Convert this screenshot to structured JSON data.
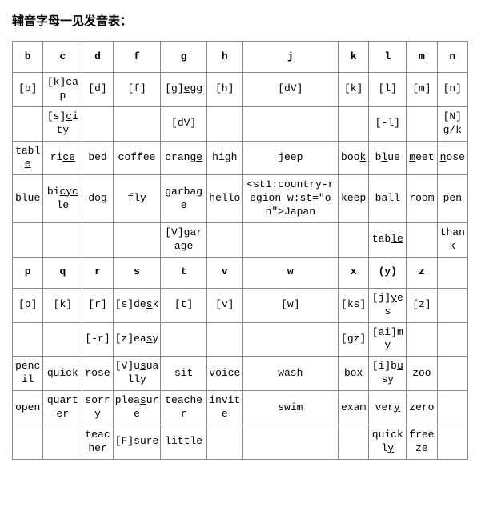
{
  "title": "辅音字母一见发音表：",
  "headers1": [
    "b",
    "c",
    "d",
    "f",
    "g",
    "h",
    "j",
    "k",
    "l",
    "m",
    "n"
  ],
  "headers2": [
    "p",
    "q",
    "r",
    "s",
    "t",
    "v",
    "w",
    "x",
    "(y)",
    "z",
    ""
  ],
  "r1": {
    "b": "[b]",
    "c_pre": "[k]",
    "c_ul": "c",
    "c_post": "ap",
    "d": "[d]",
    "f": "[f]",
    "g_pre": "[g]",
    "g_ul": "e",
    "g_post": "gg",
    "h": "[h]",
    "j": "[dV]",
    "k": "[k]",
    "l": "[l]",
    "m": "[m]",
    "n": "[n]"
  },
  "r2": {
    "c_pre": "[s]",
    "c_ul": "c",
    "c_post": "ity",
    "g": "[dV]",
    "l": "[-l]",
    "n_pre": "[N]",
    "n_ul": "g",
    "n_post": "/k"
  },
  "r3": {
    "b_pre": "tabl",
    "b_ul": "e",
    "c_pre": "ri",
    "c_ul": "ce",
    "d": "bed",
    "f": "coffee",
    "g_pre": "oran",
    "g_ul": "ge",
    "h": "high",
    "j": "jeep",
    "k_pre": "boo",
    "k_ul": "k",
    "l_pre": "b",
    "l_ul": "l",
    "l_post": "ue",
    "m_pre": "",
    "m_ul": "m",
    "m_post": "eet",
    "n_pre": "",
    "n_ul": "n",
    "n_post": "ose"
  },
  "r4": {
    "b": "blue",
    "c_pre": "bi",
    "c_ul": "cyc",
    "c_post": "le",
    "d": "dog",
    "f": "fly",
    "g_pre": "garba",
    "g_ul": "g",
    "g_post": "e",
    "h": "hello",
    "j": "<st1:country-region w:st=\"on\">Japan",
    "k_pre": "kee",
    "k_ul": "p",
    "l_pre": "ba",
    "l_ul": "ll",
    "m_pre": "roo",
    "m_ul": "m",
    "n_pre": "pe",
    "n_ul": "n"
  },
  "r5": {
    "g_pre": "[V]gar",
    "g_ul": "a",
    "g_post": "ge",
    "l_pre": "tab",
    "l_ul": "le",
    "n": "thank"
  },
  "r6": {
    "p": "[p]",
    "q": "[k]",
    "r": "[r]",
    "s_pre": "[s]de",
    "s_ul": "s",
    "s_post": "k",
    "t": "[t]",
    "v": "[v]",
    "w": "[w]",
    "x": "[ks]",
    "y_pre": "[j]",
    "y_ul": "y",
    "y_post": "es",
    "z": "[z]"
  },
  "r7": {
    "r": "[-r]",
    "s_pre": "[z]ea",
    "s_ul": "s",
    "s_post": "y",
    "x": "[gz]",
    "y_pre": "[ai]m",
    "y_ul": "y"
  },
  "r8": {
    "p": "pencil",
    "q": "quick",
    "r": "rose",
    "s_pre": "[V]u",
    "s_ul": "s",
    "s_post": "ually",
    "t": "sit",
    "v": "voice",
    "w": "wash",
    "x": "box",
    "y_pre": "[i]b",
    "y_ul": "u",
    "y_post": "sy",
    "z": "zoo"
  },
  "r9": {
    "p": "open",
    "q": "quarter",
    "r": "sorry",
    "s_pre": "plea",
    "s_ul": "s",
    "s_post": "ure",
    "t": "teacher",
    "v": "invite",
    "w": "swim",
    "x": "exam",
    "y_pre": "ver",
    "y_ul": "y",
    "z": "zero"
  },
  "r10": {
    "r": "teacher",
    "s_pre": "[F]",
    "s_ul": "s",
    "s_post": "ure",
    "t": "little",
    "y_pre": "quickl",
    "y_ul": "y",
    "z": "freeze"
  }
}
